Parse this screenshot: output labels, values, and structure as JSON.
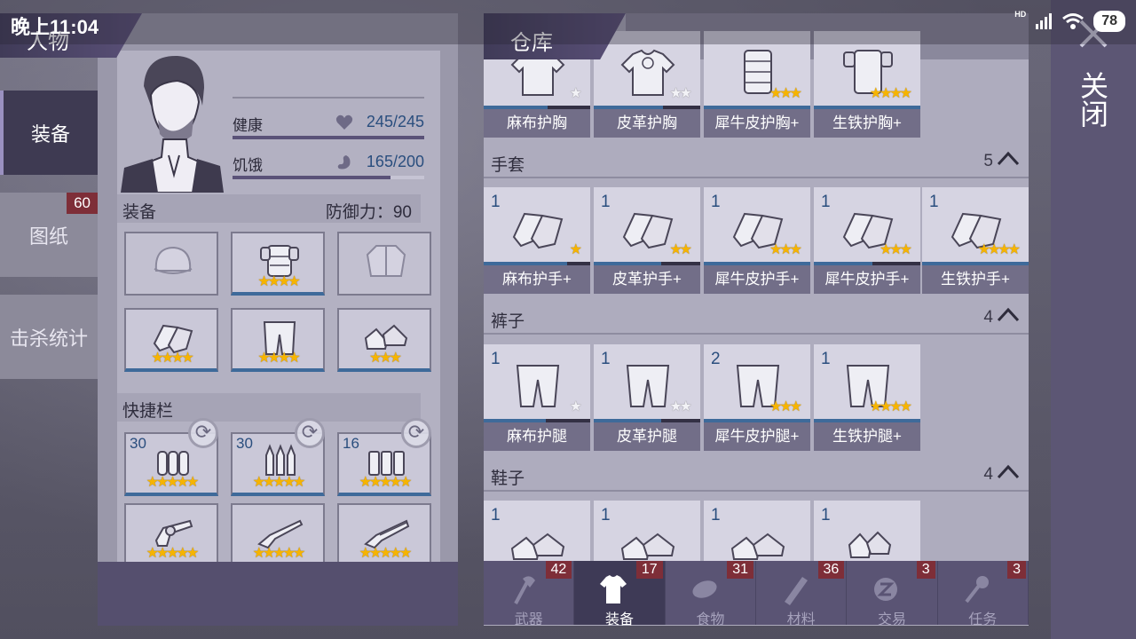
{
  "status_bar": {
    "time": "晚上11:04",
    "network": "HD",
    "battery": "78"
  },
  "left_nav": [
    {
      "label": "装备",
      "active": true,
      "badge": ""
    },
    {
      "label": "图纸",
      "active": false,
      "badge": "60"
    },
    {
      "label": "击杀统计",
      "active": false,
      "badge": ""
    }
  ],
  "character": {
    "header": "人物",
    "health": {
      "label": "健康",
      "value": "245/245",
      "ratio": 1.0
    },
    "hunger": {
      "label": "饥饿",
      "value": "165/200",
      "ratio": 0.825
    },
    "equipment_title": "装备",
    "defense": "防御力：90",
    "slots": [
      {
        "icon": "hat-icon",
        "stars": "",
        "empty": true
      },
      {
        "icon": "chest-armor-icon",
        "stars": "★★★★",
        "empty": false
      },
      {
        "icon": "jacket-icon",
        "stars": "",
        "empty": true
      },
      {
        "icon": "gloves-icon",
        "stars": "★★★★",
        "empty": false
      },
      {
        "icon": "pants-icon",
        "stars": "★★★★",
        "empty": false
      },
      {
        "icon": "shoes-icon",
        "stars": "★★★",
        "empty": false
      }
    ],
    "quickbar_title": "快捷栏",
    "quickbar": [
      {
        "icon": "ammo-icon",
        "count": "30",
        "stars": "★★★★★"
      },
      {
        "icon": "rifle-ammo-icon",
        "count": "30",
        "stars": "★★★★★"
      },
      {
        "icon": "shotgun-shells-icon",
        "count": "16",
        "stars": "★★★★★"
      },
      {
        "icon": "revolver-icon",
        "count": "",
        "stars": "★★★★★"
      },
      {
        "icon": "shotgun-icon",
        "count": "",
        "stars": "★★★★★"
      },
      {
        "icon": "double-barrel-icon",
        "count": "",
        "stars": "★★★★★"
      }
    ]
  },
  "storage": {
    "header": "仓库",
    "chest_items": [
      {
        "name": "麻布护胸",
        "stars": "★",
        "gray": true,
        "progress": 0.6
      },
      {
        "name": "皮革护胸",
        "stars": "★★",
        "gray": true,
        "progress": 0.65
      },
      {
        "name": "犀牛皮护胸+",
        "stars": "★★★",
        "gray": false,
        "progress": 1.0
      },
      {
        "name": "生铁护胸+",
        "stars": "★★★★",
        "gray": false,
        "progress": 1.0
      }
    ],
    "categories": [
      {
        "title": "手套",
        "count": "5",
        "items": [
          {
            "qty": "1",
            "name": "麻布护手+",
            "stars": "★",
            "gray": false,
            "progress": 0.78
          },
          {
            "qty": "1",
            "name": "皮革护手+",
            "stars": "★★",
            "gray": false,
            "progress": 0.63
          },
          {
            "qty": "1",
            "name": "犀牛皮护手+",
            "stars": "★★★",
            "gray": false,
            "progress": 1.0
          },
          {
            "qty": "1",
            "name": "犀牛皮护手+",
            "stars": "★★★",
            "gray": false,
            "progress": 0.55
          },
          {
            "qty": "1",
            "name": "生铁护手+",
            "stars": "★★★★",
            "gray": false,
            "progress": 1.0
          }
        ]
      },
      {
        "title": "裤子",
        "count": "4",
        "items": [
          {
            "qty": "1",
            "name": "麻布护腿",
            "stars": "★",
            "gray": true,
            "progress": 0.58
          },
          {
            "qty": "1",
            "name": "皮革护腿",
            "stars": "★★",
            "gray": true,
            "progress": 0.63
          },
          {
            "qty": "2",
            "name": "犀牛皮护腿+",
            "stars": "★★★",
            "gray": false,
            "progress": 1.0
          },
          {
            "qty": "1",
            "name": "生铁护腿+",
            "stars": "★★★★",
            "gray": false,
            "progress": 1.0
          }
        ]
      },
      {
        "title": "鞋子",
        "count": "4",
        "items": [
          {
            "qty": "1"
          },
          {
            "qty": "1"
          },
          {
            "qty": "1"
          },
          {
            "qty": "1"
          }
        ]
      }
    ]
  },
  "bottom_tabs": [
    {
      "label": "武器",
      "count": "42",
      "active": false,
      "icon": "axe-icon"
    },
    {
      "label": "装备",
      "count": "17",
      "active": true,
      "icon": "shirt-icon"
    },
    {
      "label": "食物",
      "count": "31",
      "active": false,
      "icon": "food-icon"
    },
    {
      "label": "材料",
      "count": "36",
      "active": false,
      "icon": "wood-icon"
    },
    {
      "label": "交易",
      "count": "3",
      "active": false,
      "icon": "coin-icon"
    },
    {
      "label": "任务",
      "count": "3",
      "active": false,
      "icon": "key-icon"
    }
  ],
  "close_label": "关闭",
  "colors": {
    "accent_blue": "#3e6a9a",
    "badge_red": "#7e2e38",
    "star_gold": "#f6b400"
  }
}
